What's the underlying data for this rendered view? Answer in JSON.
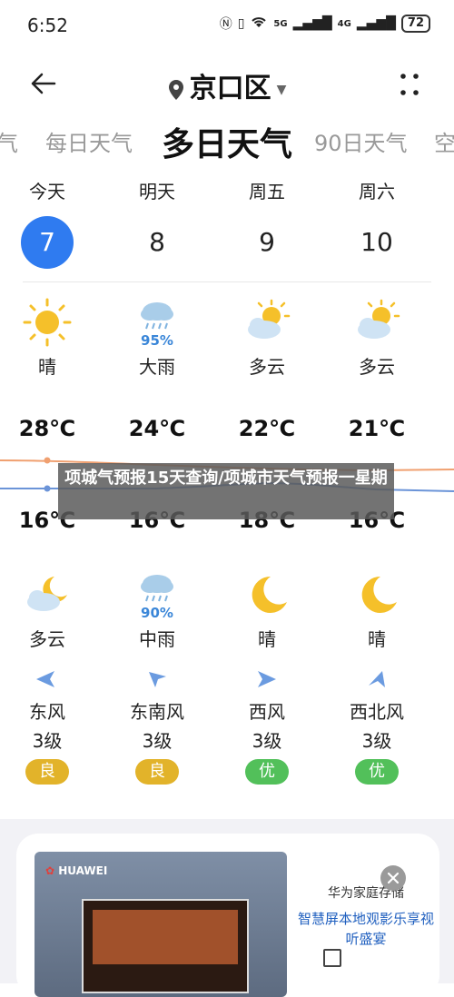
{
  "status": {
    "time": "6:52",
    "network": "5G",
    "network2": "4G",
    "battery": "72"
  },
  "header": {
    "location": "京口区"
  },
  "tabs": [
    "气",
    "每日天气",
    "多日天气",
    "90日天气",
    "空"
  ],
  "days": [
    {
      "day": "今天",
      "date": "7",
      "today": true,
      "weather": "晴",
      "icon": "sun-icon",
      "high": "28℃",
      "low": "16℃",
      "night": "多云",
      "night_icon": "partly-cloudy-night-icon",
      "wind": "东风",
      "level": "3级",
      "aqi": "良",
      "aqi_color": "#e2b32a"
    },
    {
      "day": "明天",
      "date": "8",
      "today": false,
      "weather": "大雨",
      "icon": "heavy-rain-icon",
      "precip": "95%",
      "high": "24℃",
      "low": "16℃",
      "night": "中雨",
      "night_icon": "rain-icon",
      "night_precip": "90%",
      "wind": "东南风",
      "level": "3级",
      "aqi": "良",
      "aqi_color": "#e2b32a"
    },
    {
      "day": "周五",
      "date": "9",
      "today": false,
      "weather": "多云",
      "icon": "partly-cloudy-icon",
      "high": "22℃",
      "low": "18℃",
      "night": "晴",
      "night_icon": "moon-icon",
      "wind": "西风",
      "level": "3级",
      "aqi": "优",
      "aqi_color": "#52c05a"
    },
    {
      "day": "周六",
      "date": "10",
      "today": false,
      "weather": "多云",
      "icon": "partly-cloudy-icon",
      "high": "21℃",
      "low": "16℃",
      "night": "晴",
      "night_icon": "moon-icon",
      "wind": "西北风",
      "level": "3级",
      "aqi": "优",
      "aqi_color": "#52c05a"
    }
  ],
  "overlay_text": "项城气预报15天查询/项城市天气预报一星期",
  "ad": {
    "brand": "HUAWEI",
    "title": "华为家庭存储",
    "subtitle": "智慧屏本地观影乐享视听盛宴"
  },
  "colors": {
    "accent": "#2f7bf0",
    "high_line": "#f0a070",
    "low_line": "#6b94d8"
  }
}
